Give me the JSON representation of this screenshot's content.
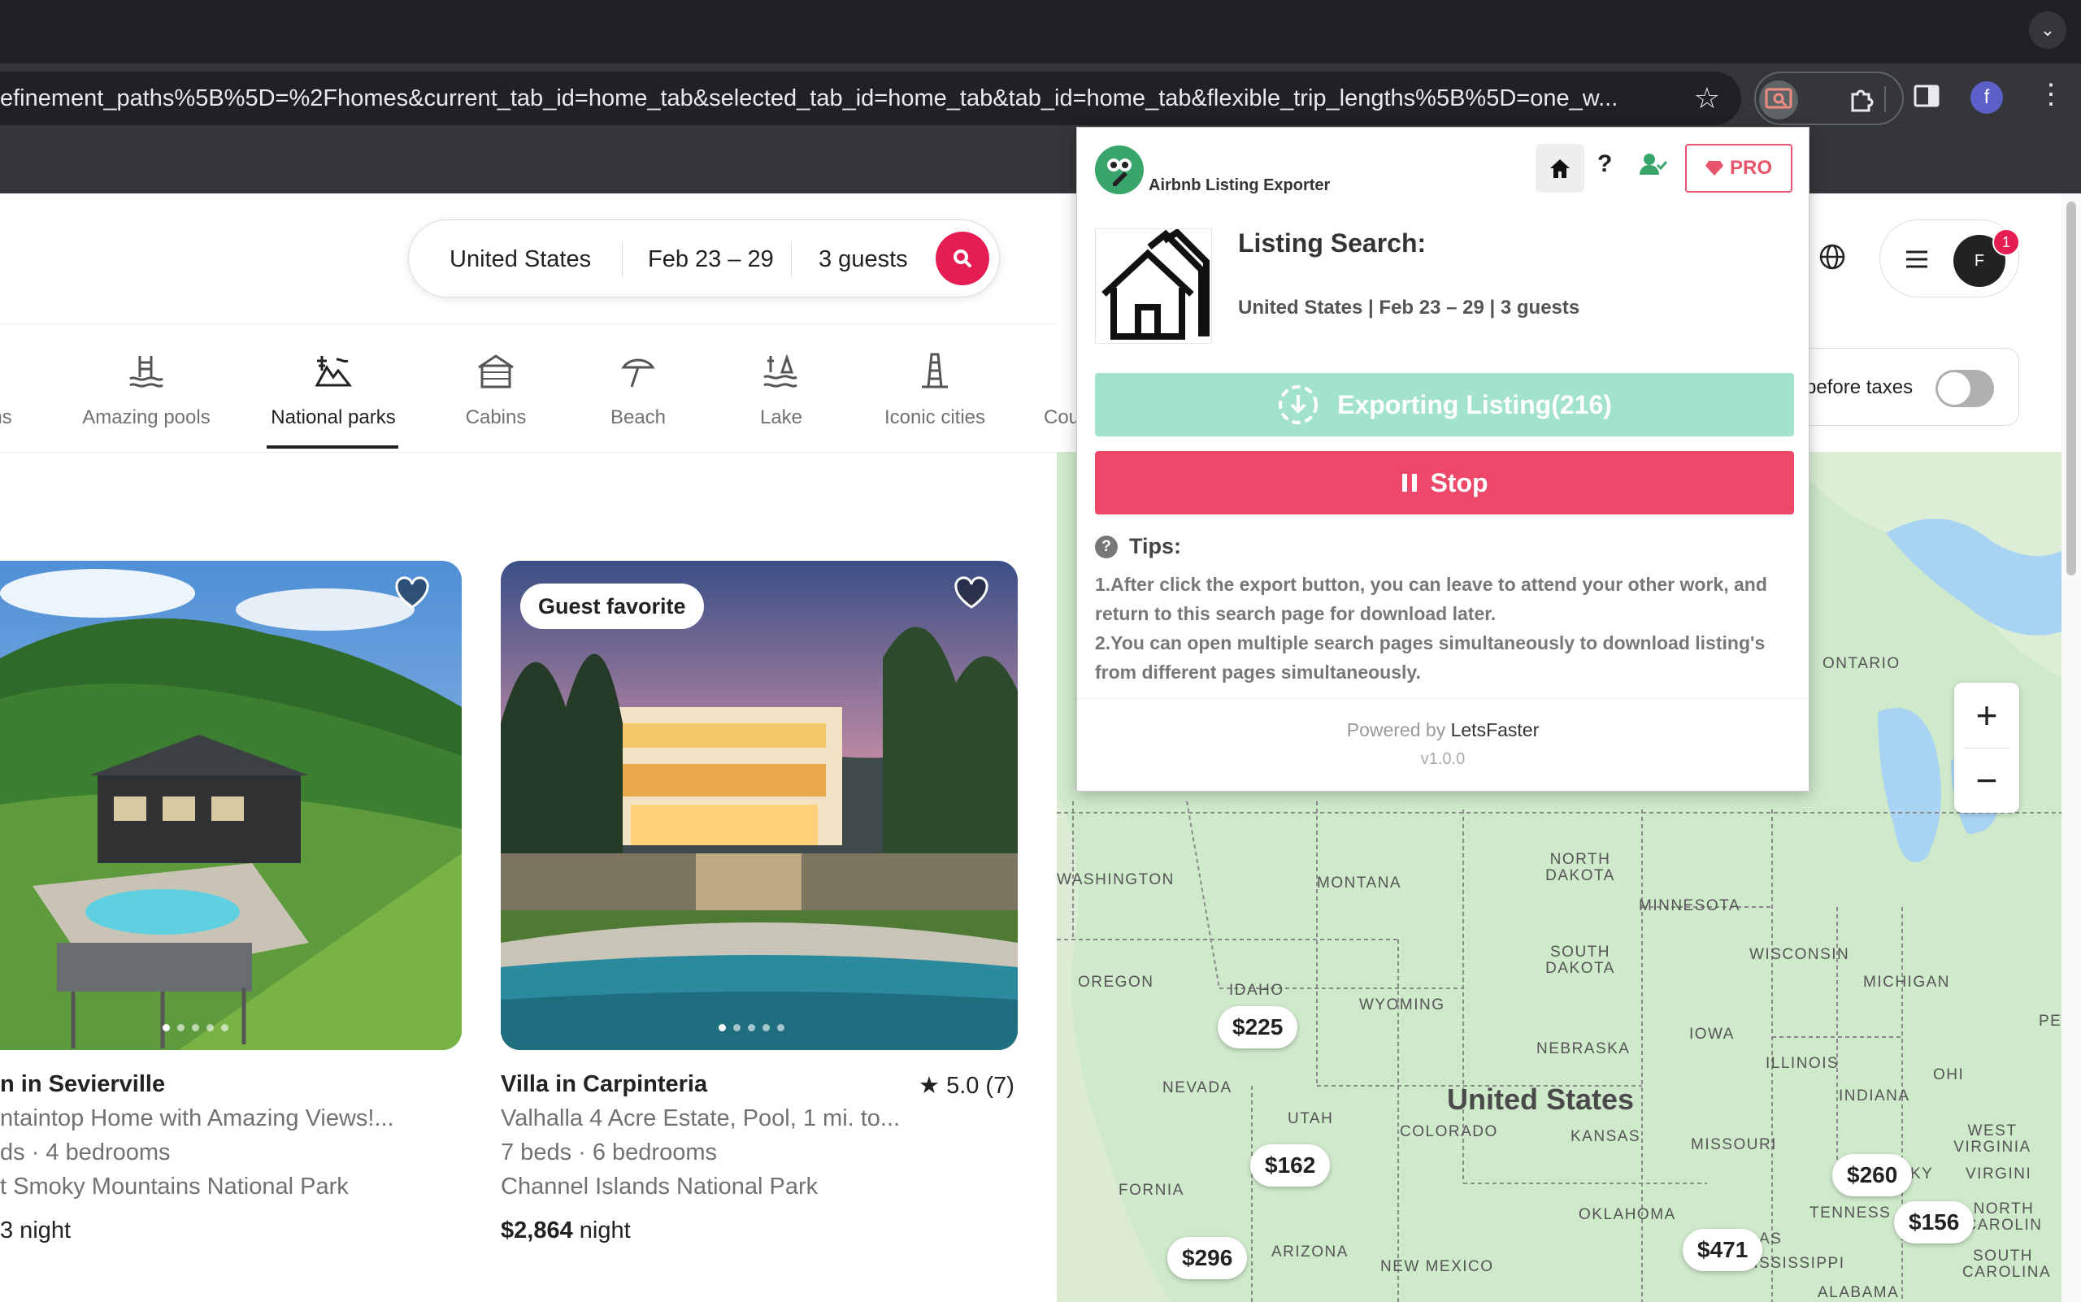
{
  "browser": {
    "url": "efinement_paths%5B%5D=%2Fhomes&current_tab_id=home_tab&selected_tab_id=home_tab&tab_id=home_tab&flexible_trip_lengths%5B%5D=one_w...",
    "profile_initial": "f"
  },
  "search": {
    "location": "United States",
    "dates": "Feb 23 – 29",
    "guests": "3 guests"
  },
  "user": {
    "avatar_initial": "F",
    "notification_count": "1"
  },
  "categories": [
    {
      "label": "ns",
      "icon": "partial-icon"
    },
    {
      "label": "Amazing pools",
      "icon": "pool-icon"
    },
    {
      "label": "National parks",
      "icon": "national-park-icon",
      "active": true
    },
    {
      "label": "Cabins",
      "icon": "cabin-icon"
    },
    {
      "label": "Beach",
      "icon": "beach-umbrella-icon"
    },
    {
      "label": "Lake",
      "icon": "lake-icon"
    },
    {
      "label": "Iconic cities",
      "icon": "city-icon"
    },
    {
      "label": "Cou",
      "icon": "countryside-icon"
    }
  ],
  "taxes": {
    "label": "before taxes",
    "enabled": false
  },
  "listings": [
    {
      "title": "n in Sevierville",
      "line1": "ntaintop Home with Amazing Views!...",
      "line2": "ds · 4 bedrooms",
      "line3": "t Smoky Mountains National Park",
      "price": "",
      "price_suffix": "3 night"
    },
    {
      "badge": "Guest favorite",
      "title": "Villa in Carpinteria",
      "rating": "5.0 (7)",
      "line1": "Valhalla 4 Acre Estate, Pool, 1 mi. to...",
      "line2": "7 beds · 6 bedrooms",
      "line3": "Channel Islands National Park",
      "price": "$2,864",
      "price_suffix": " night"
    }
  ],
  "map": {
    "country_label": "United States",
    "zoom_in": "+",
    "zoom_out": "−",
    "price_pins": [
      "$225",
      "$162",
      "$296",
      "$471",
      "$260",
      "$156"
    ],
    "regions": [
      "ONTARIO",
      "WASHINGTON",
      "MONTANA",
      "NORTH DAKOTA",
      "MINNESOTA",
      "OREGON",
      "IDAHO",
      "SOUTH DAKOTA",
      "WISCONSIN",
      "MICHIGAN",
      "WYOMING",
      "IOWA",
      "NEBRASKA",
      "ILLINOIS",
      "OHI",
      "NEVADA",
      "UTAH",
      "INDIANA",
      "COLORADO",
      "KANSAS",
      "MISSOURI",
      "WEST VIRGINIA",
      "FORNIA",
      "KY",
      "VIRGINI",
      "OKLAHOMA",
      "TENNESS",
      "NORTH CAROLIN",
      "ARIZONA",
      "NEW MEXICO",
      "AS",
      "MISSISSIPPI",
      "ALABAMA",
      "SOUTH CAROLINA",
      "PE"
    ]
  },
  "extension": {
    "name": "Airbnb Listing Exporter",
    "pro_label": "PRO",
    "help": "?",
    "heading": "Listing Search:",
    "search_summary": "United States | Feb 23 – 29 | 3 guests",
    "export_label": "Exporting Listing(216)",
    "stop_label": "Stop",
    "tips_title": "Tips:",
    "tip1": "1.After click the export button, you can leave to attend your other work, and return to this search page for download later.",
    "tip2": "2.You can open multiple search pages simultaneously to download listing's from different pages simultaneously.",
    "powered_prefix": "Powered by ",
    "powered_brand": "LetsFaster",
    "version": "v1.0.0"
  }
}
